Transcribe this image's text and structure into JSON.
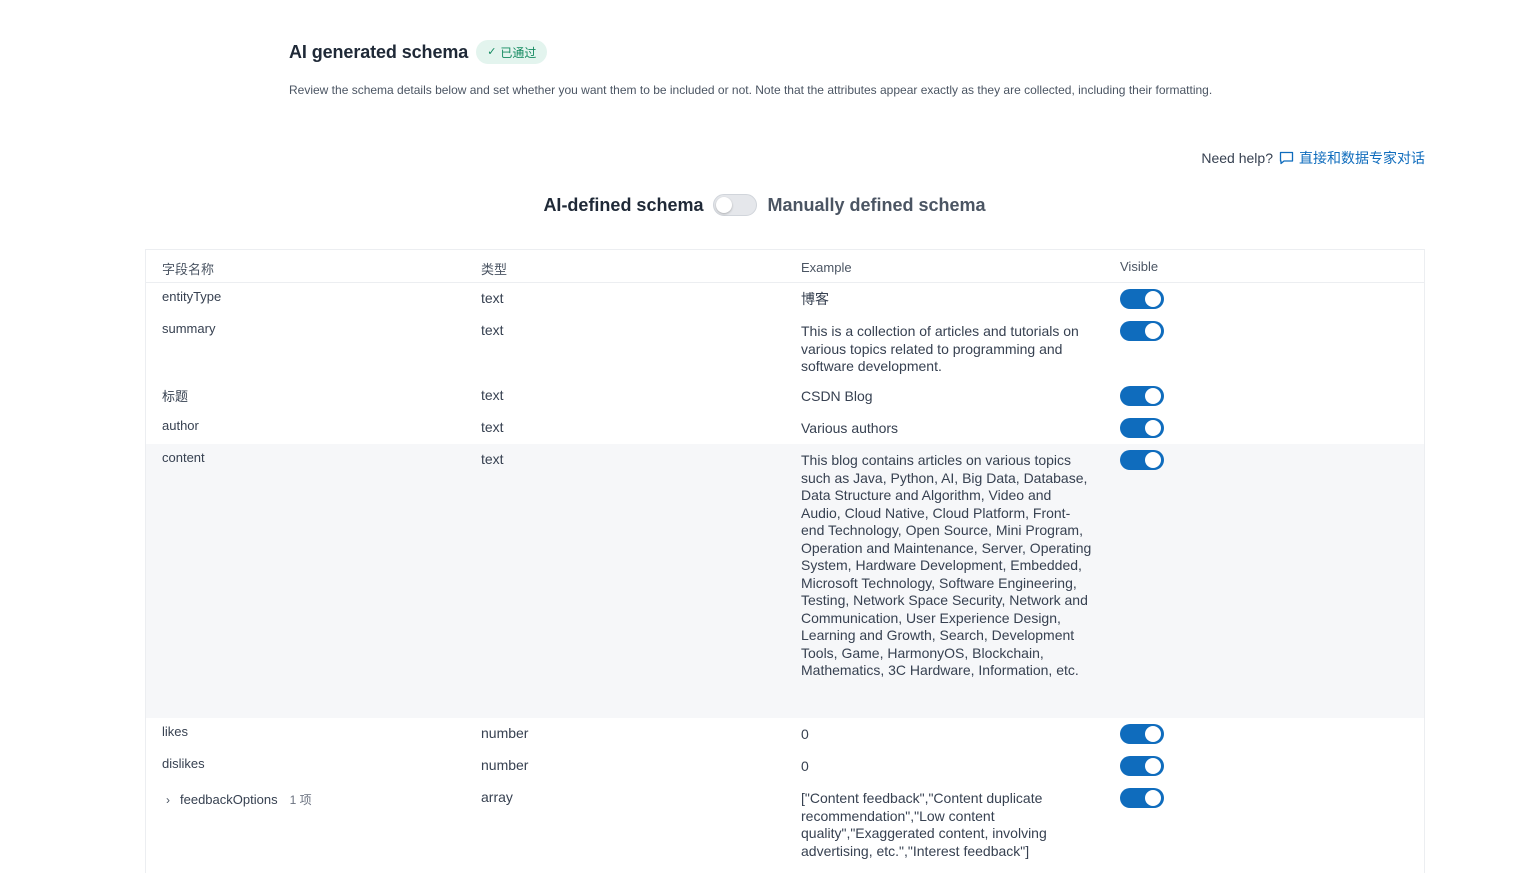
{
  "header": {
    "title": "AI generated schema",
    "badge": "已通过",
    "description": "Review the schema details below and set whether you want them to be included or not. Note that the attributes appear exactly as they are collected, including their formatting."
  },
  "help": {
    "label": "Need help?",
    "link": "直接和数据专家对话"
  },
  "schema_toggle": {
    "left_label": "AI-defined schema",
    "right_label": "Manually defined schema",
    "manual_enabled": false
  },
  "table": {
    "columns": {
      "name": "字段名称",
      "type": "类型",
      "example": "Example",
      "visible": "Visible"
    },
    "rows": [
      {
        "name": "entityType",
        "type": "text",
        "example": "博客",
        "visible": true
      },
      {
        "name": "summary",
        "type": "text",
        "example": "This is a collection of articles and tutorials on various topics related to programming and software development.",
        "visible": true
      },
      {
        "name": "标题",
        "type": "text",
        "example": "CSDN Blog",
        "visible": true
      },
      {
        "name": "author",
        "type": "text",
        "example": "Various authors",
        "visible": true
      },
      {
        "name": "content",
        "type": "text",
        "example": "This blog contains articles on various topics such as Java, Python, AI, Big Data, Database, Data Structure and Algorithm, Video and Audio, Cloud Native, Cloud Platform, Front-end Technology, Open Source, Mini Program, Operation and Maintenance, Server, Operating System, Hardware Development, Embedded, Microsoft Technology, Software Engineering, Testing, Network Space Security, Network and Communication, User Experience Design, Learning and Growth, Search, Development Tools, Game, HarmonyOS, Blockchain, Mathematics, 3C Hardware, Information, etc.",
        "visible": true
      },
      {
        "name": "likes",
        "type": "number",
        "example": "0",
        "visible": true
      },
      {
        "name": "dislikes",
        "type": "number",
        "example": "0",
        "visible": true
      },
      {
        "name": "feedbackOptions",
        "type": "array",
        "example": "[\"Content feedback\",\"Content duplicate recommendation\",\"Low content quality\",\"Exaggerated content, involving advertising, etc.\",\"Interest feedback\"]",
        "visible": true,
        "count": "1 项"
      }
    ]
  },
  "colors": {
    "accent": "#0f6cbd",
    "badge_bg": "#e3f4ee",
    "badge_text": "#138a60"
  }
}
